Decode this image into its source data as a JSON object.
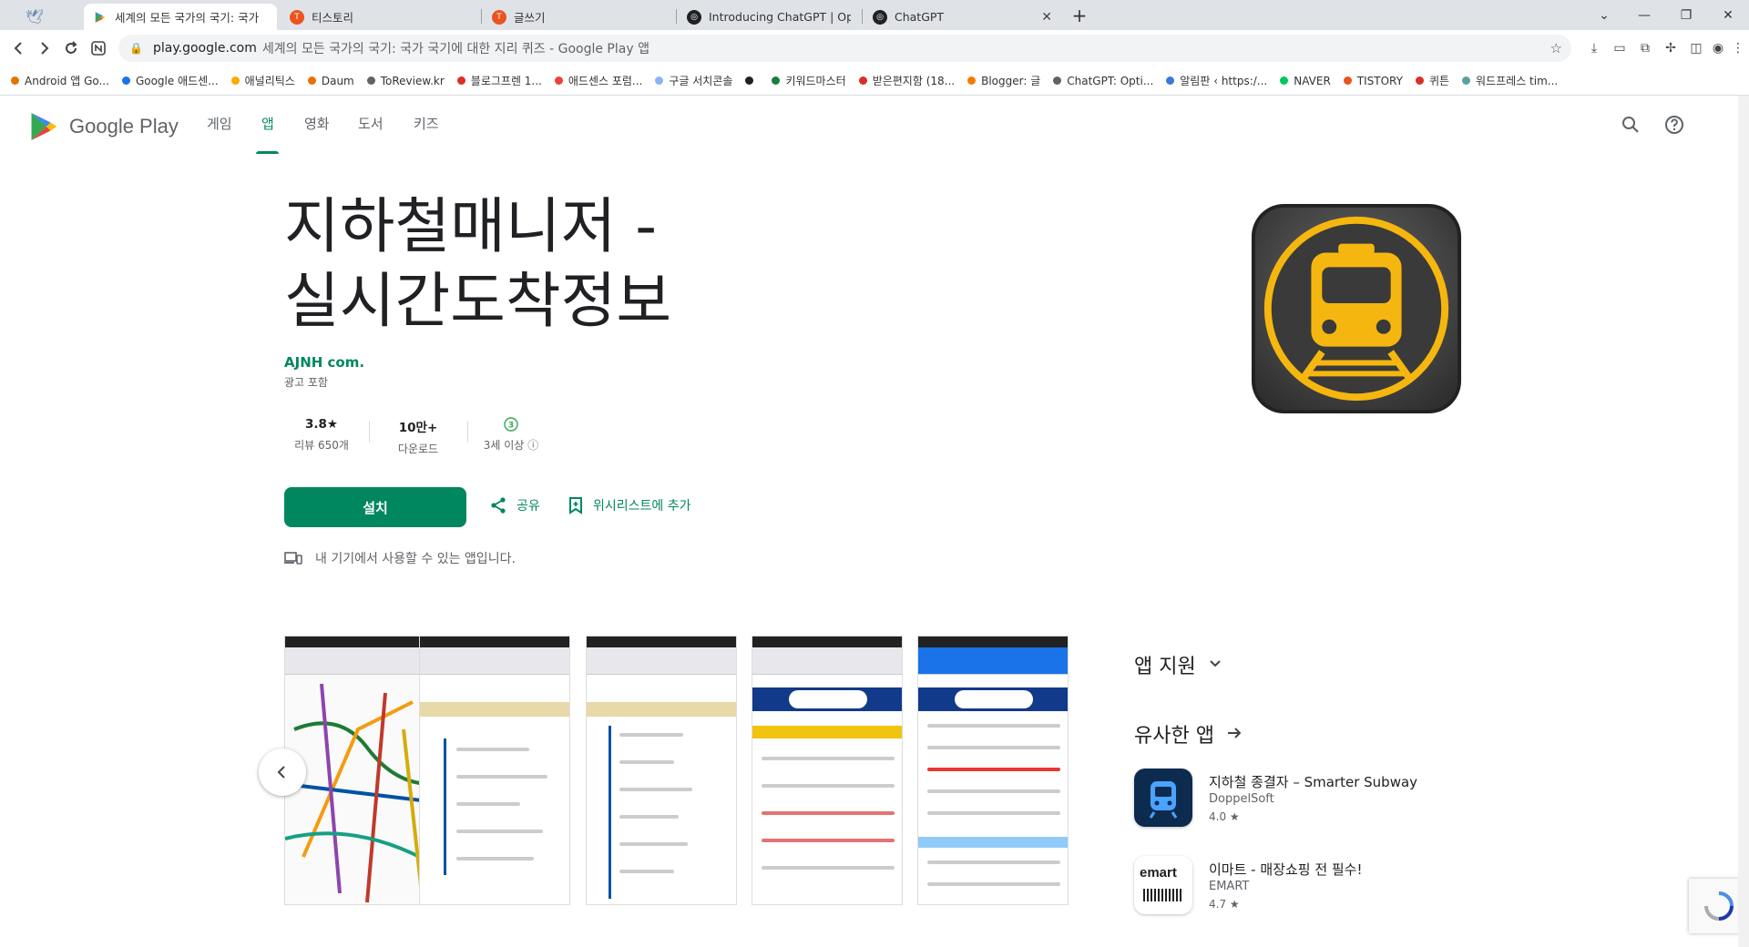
{
  "tabs": [
    {
      "label": "세계의 모든 국가의 국기: 국가",
      "favicon": "google-play-icon",
      "active": true
    },
    {
      "label": "티스토리",
      "favicon": "tistory-icon",
      "active": false
    },
    {
      "label": "글쓰기",
      "favicon": "tistory-icon",
      "active": false
    },
    {
      "label": "Introducing ChatGPT | OpenA",
      "favicon": "openai-icon",
      "active": false
    },
    {
      "label": "ChatGPT",
      "favicon": "openai-icon",
      "active": false
    }
  ],
  "window": {
    "new_tab": "+",
    "minimize": "—",
    "restore": "❐",
    "close": "✕",
    "tab_search": "⌄"
  },
  "address": {
    "host": "play.google.com",
    "page_title": "세계의 모든 국가의 국기: 국가 국기에 대한 지리 퀴즈 - Google Play 앱"
  },
  "bookmarks": [
    {
      "label": "Android 앱 Go...",
      "color": "#e37400"
    },
    {
      "label": "Google 애드센...",
      "color": "#1a73e8"
    },
    {
      "label": "애널리틱스",
      "color": "#f9ab00"
    },
    {
      "label": "Daum",
      "color": "#e8710a"
    },
    {
      "label": "ToReview.kr",
      "color": "#5f6368"
    },
    {
      "label": "블로그프렌 1...",
      "color": "#d93025"
    },
    {
      "label": "애드센스 포럼...",
      "color": "#ea4335"
    },
    {
      "label": "구글 서치콘솔",
      "color": "#8ab4f8"
    },
    {
      "label": "",
      "color": "#202124"
    },
    {
      "label": "키워드마스터",
      "color": "#188038"
    },
    {
      "label": "받은편지함 (18...",
      "color": "#d93025"
    },
    {
      "label": "Blogger: 글",
      "color": "#f57c00"
    },
    {
      "label": "ChatGPT: Opti...",
      "color": "#5f6368"
    },
    {
      "label": "알림판 ‹ https:/...",
      "color": "#3c78d8"
    },
    {
      "label": "NAVER",
      "color": "#03c75a"
    },
    {
      "label": "TISTORY",
      "color": "#eb531f"
    },
    {
      "label": "퀴튼",
      "color": "#d93025"
    },
    {
      "label": "워드프레스 tim...",
      "color": "#5f9ea0"
    }
  ],
  "header": {
    "logo_text": "Google Play",
    "nav": [
      "게임",
      "앱",
      "영화",
      "도서",
      "키즈"
    ],
    "active_nav": "앱"
  },
  "app": {
    "title_line1": "지하철매니저 -",
    "title_line2": "실시간도착정보",
    "developer": "AJNH com.",
    "ads": "광고 포함",
    "rating_value": "3.8★",
    "rating_label": "리뷰 650개",
    "downloads_value": "10만+",
    "downloads_label": "다운로드",
    "age_badge": "3",
    "age_label": "3세 이상",
    "install": "설치",
    "share": "공유",
    "wishlist": "위시리스트에 추가",
    "device_note": "내 기기에서 사용할 수 있는 앱입니다.",
    "accent": "#01875f"
  },
  "side": {
    "support_title": "앱 지원",
    "similar_title": "유사한 앱",
    "similar_apps": [
      {
        "name": "지하철 종결자 – Smarter Subway",
        "developer": "DoppelSoft",
        "rating": "4.0 ★"
      },
      {
        "name": "이마트 - 매장쇼핑 전 필수!",
        "developer": "EMART",
        "rating": "4.7 ★"
      }
    ],
    "emart_logo": "emart"
  }
}
